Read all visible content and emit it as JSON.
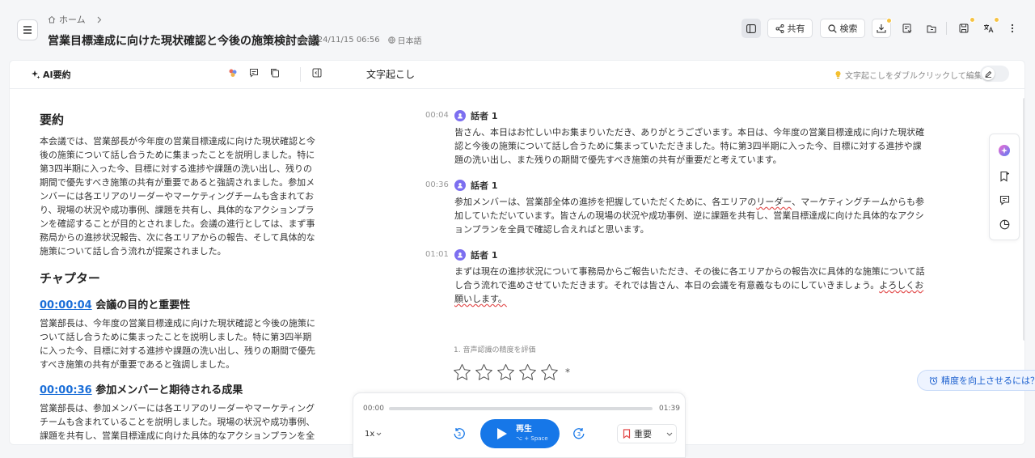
{
  "header": {
    "breadcrumb_home": "ホーム",
    "title": "営業目標達成に向けた現状確認と今後の施策検討会議",
    "date": "2024/11/15 06:56",
    "language": "日本語",
    "share_label": "共有",
    "search_label": "検索"
  },
  "left_panel": {
    "title": "AI要約",
    "summary_heading": "要約",
    "summary_text": "本会議では、営業部長が今年度の営業目標達成に向けた現状確認と今後の施策について話し合うために集まったことを説明しました。特に第3四半期に入った今、目標に対する進捗や課題の洗い出し、残りの期間で優先すべき施策の共有が重要であると強調されました。参加メンバーには各エリアのリーダーやマーケティングチームも含まれており、現場の状況や成功事例、課題を共有し、具体的なアクションプランを確認することが目的とされました。会議の進行としては、まず事務局からの進捗状況報告、次に各エリアからの報告、そして具体的な施策について話し合う流れが提案されました。",
    "chapters_heading": "チャプター",
    "chapters": [
      {
        "time": "00:00:04",
        "title": "会議の目的と重要性",
        "text": "営業部長は、今年度の営業目標達成に向けた現状確認と今後の施策について話し合うために集まったことを説明しました。特に第3四半期に入った今、目標に対する進捗や課題の洗い出し、残りの期間で優先すべき施策の共有が重要であると強調しました。"
      },
      {
        "time": "00:00:36",
        "title": "参加メンバーと期待される成果",
        "text": "営業部長は、参加メンバーには各エリアのリーダーやマーケティングチームも含まれていることを説明しました。現場の状況や成功事例、課題を共有し、営業目標達成に向けた具体的なアクションプランを全員で確認することが期待されています。"
      }
    ]
  },
  "transcript": {
    "title": "文字起こし",
    "hint": "文字起こしをダブルクリックして編集",
    "entries": [
      {
        "time": "00:04",
        "speaker": "話者 1",
        "text": "皆さん、本日はお忙しい中お集まりいただき、ありがとうございます。本日は、今年度の営業目標達成に向けた現状確認と今後の施策について話し合うために集まっていただきました。特に第3四半期に入った今、目標に対する進捗や課題の洗い出し、また残りの期間で優先すべき施策の共有が重要だと考えています。"
      },
      {
        "time": "00:36",
        "speaker": "話者 1",
        "text_a": "参加メンバーは、営業部全体の進捗を把握していただくために、各エリアの",
        "text_mark": "リーダー",
        "text_b": "、マーケティングチームからも参加していただいています。皆さんの現場の状況や成功事例、逆に課題を共有し、営業目標達成に向けた具体的なアクションプランを全員で確認し合えればと思います。"
      },
      {
        "time": "01:01",
        "speaker": "話者 1",
        "text_a": "まずは現在の進捗状況について事務局からご報告いただき、その後に各エリアからの報告次に具体的な施策について話し合う流れで進めさせていただきます。それでは皆さん、本日の会議を有意義なものにしていきましょう。",
        "text_mark": "よろしくお願いします。",
        "text_b": ""
      }
    ],
    "rating_label": "1. 音声認識の精度を評価",
    "rating_value": 0,
    "rating_max": 5,
    "asterisk": "*"
  },
  "improve_label": "精度を向上させるには？",
  "player": {
    "current_time": "00:00",
    "duration": "01:39",
    "progress": 0,
    "speed": "1x",
    "skip_back": "3",
    "skip_forward": "3",
    "play_label": "再生",
    "play_shortcut": "⌥ + Space",
    "important_label": "重要"
  },
  "colors": {
    "accent": "#1677e8",
    "link": "#1a6ed8",
    "avatar": "#7c6ff0",
    "badge": "#f6c344"
  }
}
